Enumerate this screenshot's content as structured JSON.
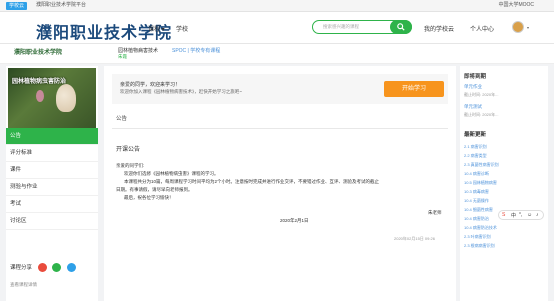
{
  "topbar": {
    "btn": "学校云",
    "welcome": "濮阳职业技术学院平台",
    "right": "中国大学MOOC"
  },
  "header": {
    "title": "濮阳职业技术学院",
    "course": "课程 ▾",
    "school": "学校",
    "search_placeholder": "搜索感兴趣的课程",
    "myschool": "我的学校云",
    "profile": "个人中心",
    "caret": "▾"
  },
  "subheader": {
    "logo": "濮阳职业技术学院",
    "course_name": "园林植物病害技术",
    "spoc": "SPOC | 学校专有课程",
    "teacher": "朱霞"
  },
  "sidebar": {
    "banner_title": "园林植物病虫害防治",
    "items": [
      "公告",
      "评分标准",
      "课件",
      "测验与作业",
      "考试",
      "讨论区"
    ],
    "share": "课程分享",
    "footer": "查看课程详情"
  },
  "main": {
    "welcome_line1": "亲爱的同学，欢迎来学习！",
    "welcome_line2": "欢迎你加入课程《园林植物病害技术》，赶快开始学习之旅吧~",
    "start_button": "开始学习",
    "section": "公告",
    "ann_title": "开课公告",
    "ann_lines": [
      "亲爱的同学们:",
      "欢迎你们选修《园林植物病虫害》课程的学习。",
      "本课程共分为10篇，每周课程学习时间平均为2个小时。注意按时完成并进行作业交评，不要错过作业、互评、测验及考试的截止",
      "日期。有事请假，请尽早向老师报到。",
      "最后，祝各位学习愉快！"
    ],
    "ann_sign": "朱老师",
    "ann_date": "2020年2月1日",
    "ann_ts": "2020年02月15日 09:26"
  },
  "rightcol": {
    "h1": "即将到期",
    "due_items": [
      {
        "name": "单元作业",
        "date": "截止时间: 2020年..."
      },
      {
        "name": "单元测试",
        "date": "截止时间: 2020年..."
      }
    ],
    "h2": "最新更新",
    "updates": [
      "2.1 病害识别",
      "2.2 病害类型",
      "2.3 真菌性病害识别",
      "10.4 病害诊断",
      "10.5 园林植物病害",
      "10.3 病毒病害",
      "10.4 无菌操作",
      "10.4 细菌性病害",
      "10.4 病害防治",
      "10.4 病害防治技术",
      "2.3 叶病害识别",
      "2.3 根病病害识别"
    ]
  },
  "colors": {
    "accent": "#2eb34a",
    "orange": "#f7941d",
    "brand": "#1c4a7c"
  }
}
